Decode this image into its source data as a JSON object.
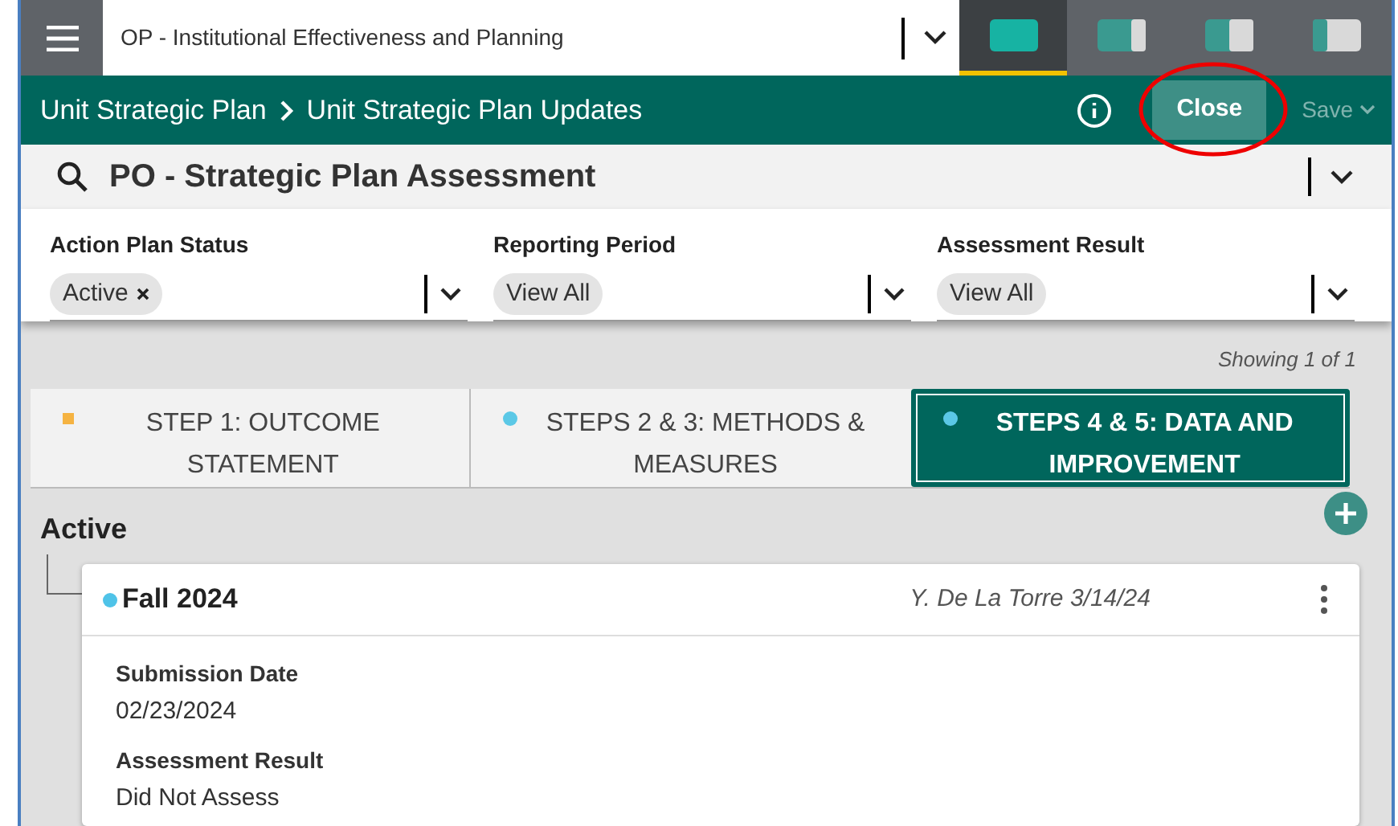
{
  "top_bar": {
    "selector": {
      "value": "OP - Institutional Effectiveness and Planning"
    },
    "layout_tabs": [
      {
        "kind": "full",
        "selected": true
      },
      {
        "kind": "right-panel",
        "selected": false
      },
      {
        "kind": "split",
        "selected": false
      },
      {
        "kind": "left-panel",
        "selected": false
      }
    ]
  },
  "header": {
    "breadcrumbs": [
      "Unit Strategic Plan",
      "Unit Strategic Plan Updates"
    ],
    "close_button": {
      "label": "Close",
      "circled": true
    },
    "save_button": {
      "label": "Save",
      "disabled": true
    }
  },
  "title_bar": {
    "title": "PO - Strategic Plan Assessment"
  },
  "filters": [
    {
      "label": "Action Plan Status",
      "chip": "Active",
      "removable": true
    },
    {
      "label": "Reporting Period",
      "chip": "View All",
      "removable": false
    },
    {
      "label": "Assessment Result",
      "chip": "View All",
      "removable": false
    }
  ],
  "showing": "Showing 1 of 1",
  "step_tabs": [
    {
      "label": "STEP 1: OUTCOME STATEMENT",
      "kind": "square",
      "color": "#f5b342",
      "selected": false
    },
    {
      "label": "STEPS 2 & 3: METHODS & MEASURES",
      "kind": "dot",
      "color": "#5bc8e6",
      "selected": false
    },
    {
      "label": "STEPS 4 & 5: DATA AND IMPROVEMENT",
      "kind": "dot",
      "color": "#5bc8e6",
      "selected": true
    }
  ],
  "section": {
    "title": "Active"
  },
  "entries": [
    {
      "title": "Fall 2024",
      "color": "#4fc3e8",
      "author": "Y. De La Torre 3/14/24",
      "fields": [
        {
          "label": "Submission Date",
          "value": "02/23/2024"
        },
        {
          "label": "Assessment Result",
          "value": "Did Not Assess"
        }
      ]
    }
  ]
}
